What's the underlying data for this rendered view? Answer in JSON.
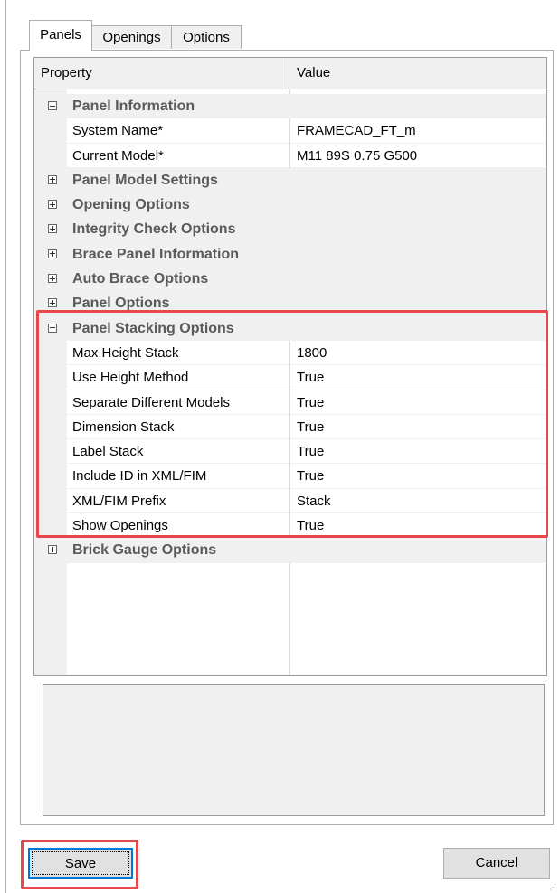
{
  "tabs": [
    {
      "label": "Panels",
      "active": true
    },
    {
      "label": "Openings",
      "active": false
    },
    {
      "label": "Options",
      "active": false
    }
  ],
  "grid": {
    "header": {
      "property": "Property",
      "value": "Value"
    },
    "rows": [
      {
        "type": "category",
        "label": "Panel Information",
        "expanded": true
      },
      {
        "type": "property",
        "name": "System Name*",
        "value": "FRAMECAD_FT_m"
      },
      {
        "type": "property",
        "name": "Current Model*",
        "value": "M11 89S 0.75 G500"
      },
      {
        "type": "category",
        "label": "Panel Model Settings",
        "expanded": false
      },
      {
        "type": "category",
        "label": "Opening Options",
        "expanded": false
      },
      {
        "type": "category",
        "label": "Integrity Check Options",
        "expanded": false
      },
      {
        "type": "category",
        "label": "Brace Panel Information",
        "expanded": false
      },
      {
        "type": "category",
        "label": "Auto Brace Options",
        "expanded": false
      },
      {
        "type": "category",
        "label": "Panel Options",
        "expanded": false
      },
      {
        "type": "category",
        "label": "Panel Stacking Options",
        "expanded": true
      },
      {
        "type": "property",
        "name": "Max Height Stack",
        "value": "1800"
      },
      {
        "type": "property",
        "name": "Use Height Method",
        "value": "True"
      },
      {
        "type": "property",
        "name": "Separate Different Models",
        "value": "True"
      },
      {
        "type": "property",
        "name": "Dimension Stack",
        "value": "True"
      },
      {
        "type": "property",
        "name": "Label Stack",
        "value": "True"
      },
      {
        "type": "property",
        "name": "Include ID in XML/FIM",
        "value": "True"
      },
      {
        "type": "property",
        "name": "XML/FIM Prefix",
        "value": "Stack"
      },
      {
        "type": "property",
        "name": "Show Openings",
        "value": "True"
      },
      {
        "type": "category",
        "label": "Brick Gauge Options",
        "expanded": false
      }
    ]
  },
  "buttons": {
    "save": "Save",
    "cancel": "Cancel"
  },
  "colors": {
    "highlight": "#e8474b",
    "focus": "#0078d7"
  }
}
